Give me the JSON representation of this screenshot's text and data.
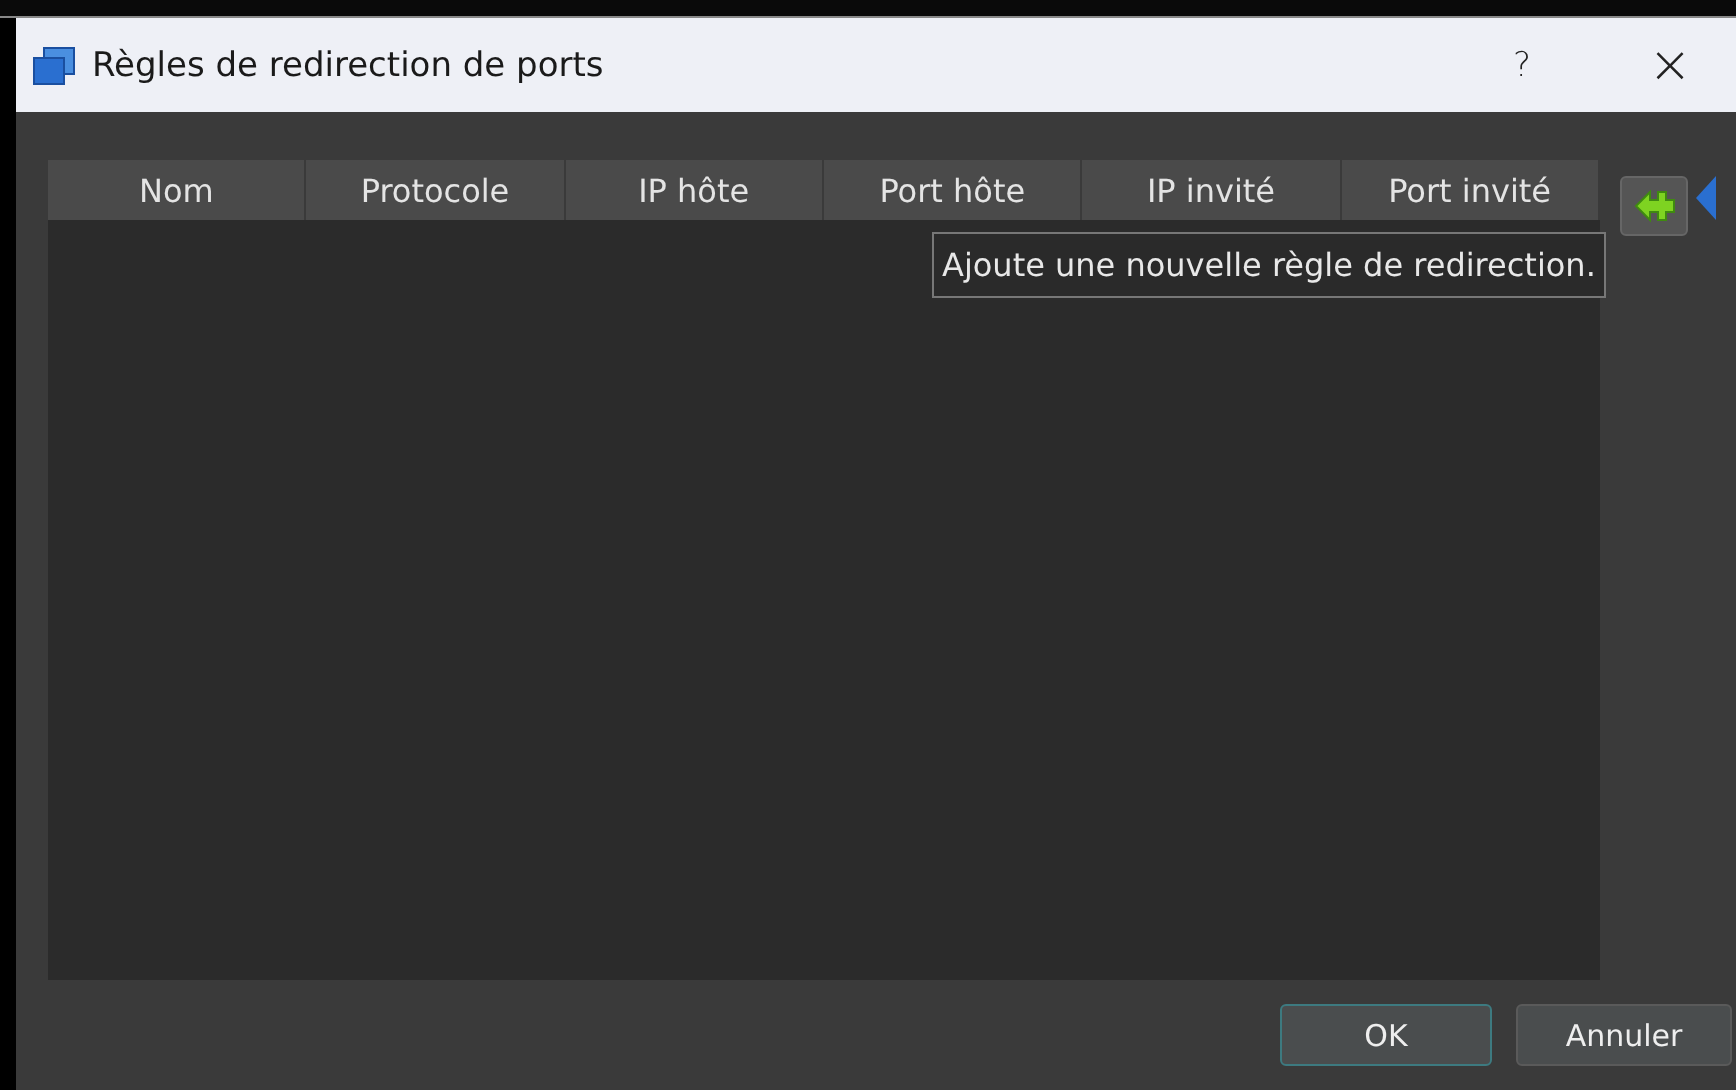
{
  "window": {
    "title": "Règles de redirection de ports",
    "help": "?",
    "close": "×"
  },
  "table": {
    "columns": [
      "Nom",
      "Protocole",
      "IP hôte",
      "Port hôte",
      "IP invité",
      "Port invité"
    ]
  },
  "tooltip": "Ajoute une nouvelle règle de redirection.",
  "buttons": [
    {
      "label": "OK",
      "default": true
    },
    {
      "label": "Annuler",
      "default": false
    }
  ]
}
